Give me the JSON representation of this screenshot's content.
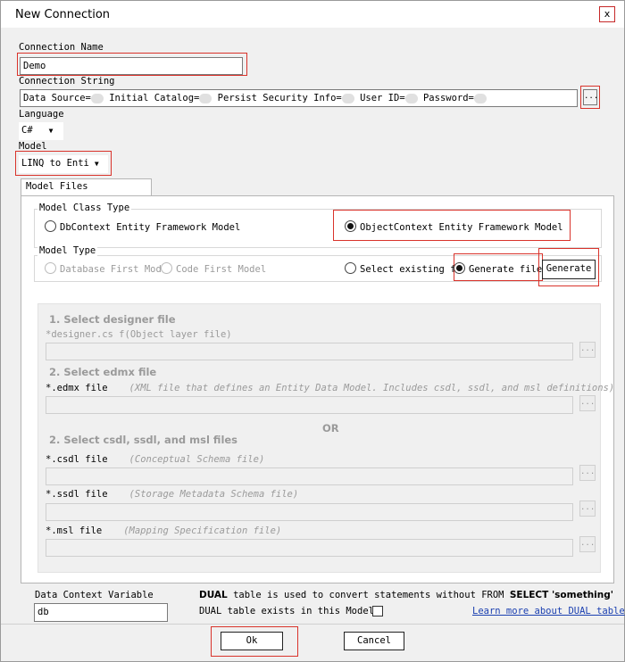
{
  "window": {
    "title": "New Connection",
    "close_glyph": "x"
  },
  "connection_name": {
    "label": "Connection Name",
    "value": "Demo"
  },
  "connection_string": {
    "label": "Connection String",
    "parts": [
      "Data Source=",
      "Initial Catalog=",
      "Persist Security Info=",
      "User ID=",
      "Password="
    ],
    "browse_label": "..."
  },
  "language": {
    "label": "Language",
    "value": "C#"
  },
  "model": {
    "label": "Model",
    "value": "LINQ to Enti"
  },
  "tab": {
    "label": "Model Files"
  },
  "model_class_type": {
    "label": "Model Class Type",
    "option1": "DbContext Entity Framework Model",
    "option2": "ObjectContext  Entity Framework Model"
  },
  "model_type": {
    "label": "Model Type",
    "option1": "Database First Mode",
    "option2": "Code First Model",
    "option3": "Select existing f",
    "option4": "Generate file",
    "generate_button": "Generate"
  },
  "files": {
    "step1_title": "1. Select designer file",
    "step1_hint": "*designer.cs f(Object layer file)",
    "step2_title": "2. Select edmx file",
    "edmx_label": "*.edmx file",
    "edmx_hint": "(XML file that defines an Entity Data Model. Includes csdl, ssdl, and msl definitions)",
    "or_label": "OR",
    "step3_title": "2. Select csdl, ssdl, and msl files",
    "csdl_label": "*.csdl file",
    "csdl_hint": "(Conceptual Schema file)",
    "ssdl_label": "*.ssdl file",
    "ssdl_hint": "(Storage Metadata Schema file)",
    "msl_label": "*.msl file",
    "msl_hint": "(Mapping Specification file)",
    "browse_label": "..."
  },
  "data_context": {
    "label": "Data Context Variable",
    "value": "db"
  },
  "dual": {
    "note_a": "DUAL",
    "note_b": " table is used to convert statements without FROM ",
    "note_c": "SELECT",
    "note_d": " 'something'",
    "checkbox_label": "DUAL table exists in this Model",
    "link": "Learn more about DUAL table"
  },
  "buttons": {
    "ok": "Ok",
    "cancel": "Cancel"
  }
}
